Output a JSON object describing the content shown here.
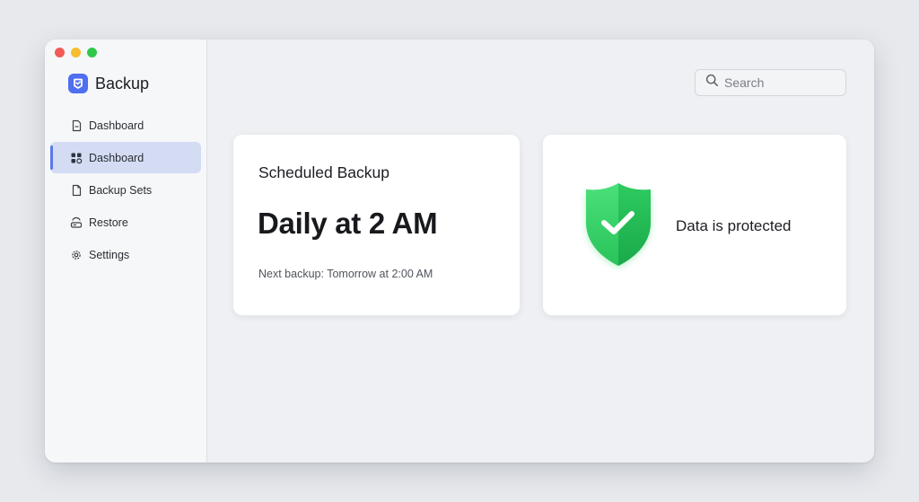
{
  "app": {
    "name": "Backup",
    "logo_icon": "backup-logo-icon",
    "accent_color": "#4f6ef0"
  },
  "sidebar": {
    "items": [
      {
        "label": "Dashboard",
        "icon": "document-icon",
        "active": false
      },
      {
        "label": "Dashboard",
        "icon": "grid-icon",
        "active": true
      },
      {
        "label": "Backup Sets",
        "icon": "file-icon",
        "active": false
      },
      {
        "label": "Restore",
        "icon": "drive-icon",
        "active": false
      },
      {
        "label": "Settings",
        "icon": "gear-icon",
        "active": false
      }
    ]
  },
  "search": {
    "placeholder": "Search",
    "value": ""
  },
  "schedule_card": {
    "title": "Scheduled Backup",
    "schedule": "Daily at 2 AM",
    "next_backup": "Next backup: Tomorrow at 2:00 AM"
  },
  "status_card": {
    "text": "Data is protected",
    "icon": "shield-check-icon",
    "status_color": "#2ecc5f"
  }
}
